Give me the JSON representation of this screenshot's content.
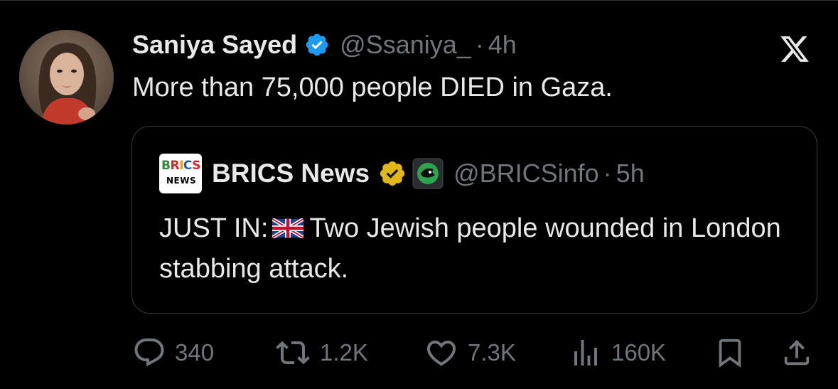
{
  "tweet": {
    "author_name": "Saniya Sayed",
    "handle": "@Ssaniya_",
    "separator": "·",
    "time": "4h",
    "text": "More than 75,000 people DIED in Gaza."
  },
  "quote": {
    "logo_line1": "BRICS",
    "logo_line2": "NEWS",
    "author_name": "BRICS News",
    "handle": "@BRICSinfo",
    "separator": "·",
    "time": "5h",
    "text_prefix": "JUST IN:",
    "flag": "uk-flag-icon",
    "text_suffix": "Two Jewish people wounded in London stabbing attack."
  },
  "actions": {
    "replies": "340",
    "reposts": "1.2K",
    "likes": "7.3K",
    "views": "160K"
  },
  "icons": [
    "verified-badge-icon",
    "x-logo-icon",
    "gold-verified-badge-icon",
    "affiliate-badge-icon",
    "reply-icon",
    "repost-icon",
    "like-icon",
    "views-icon",
    "bookmark-icon",
    "share-icon"
  ],
  "colors": {
    "background": "#000000",
    "text_primary": "#e7e9ea",
    "text_secondary": "#71767b",
    "verified_blue": "#1d9bf0",
    "verified_gold": "#e2b719",
    "border": "#38393c"
  }
}
